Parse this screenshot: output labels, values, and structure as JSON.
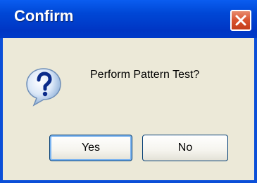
{
  "dialog": {
    "title": "Confirm",
    "message": "Perform Pattern Test?",
    "icon": "question-icon",
    "close_icon": "close-icon",
    "buttons": {
      "yes_label": "Yes",
      "no_label": "No"
    }
  },
  "colors": {
    "titlebar": "#0047d6",
    "body": "#ece9d8",
    "close": "#d8522e"
  }
}
